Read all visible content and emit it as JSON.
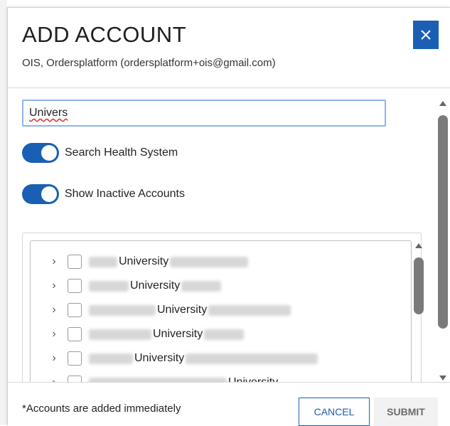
{
  "dialog": {
    "title": "ADD ACCOUNT",
    "subtitle": "OIS, Ordersplatform (ordersplatform+ois@gmail.com)",
    "close_icon": "close-icon"
  },
  "search": {
    "value": "Univers"
  },
  "toggles": [
    {
      "label": "Search Health System",
      "checked": true
    },
    {
      "label": "Show Inactive Accounts",
      "checked": true
    }
  ],
  "results": [
    {
      "label": "University"
    },
    {
      "label": "University"
    },
    {
      "label": "University"
    },
    {
      "label": "University"
    },
    {
      "label": "University"
    },
    {
      "label": "University"
    }
  ],
  "footer": {
    "note": "*Accounts are added immediately",
    "cancel_label": "CANCEL",
    "submit_label": "SUBMIT"
  },
  "colors": {
    "accent": "#1a5fb4",
    "disabled_button_bg": "#f2f2f2"
  }
}
